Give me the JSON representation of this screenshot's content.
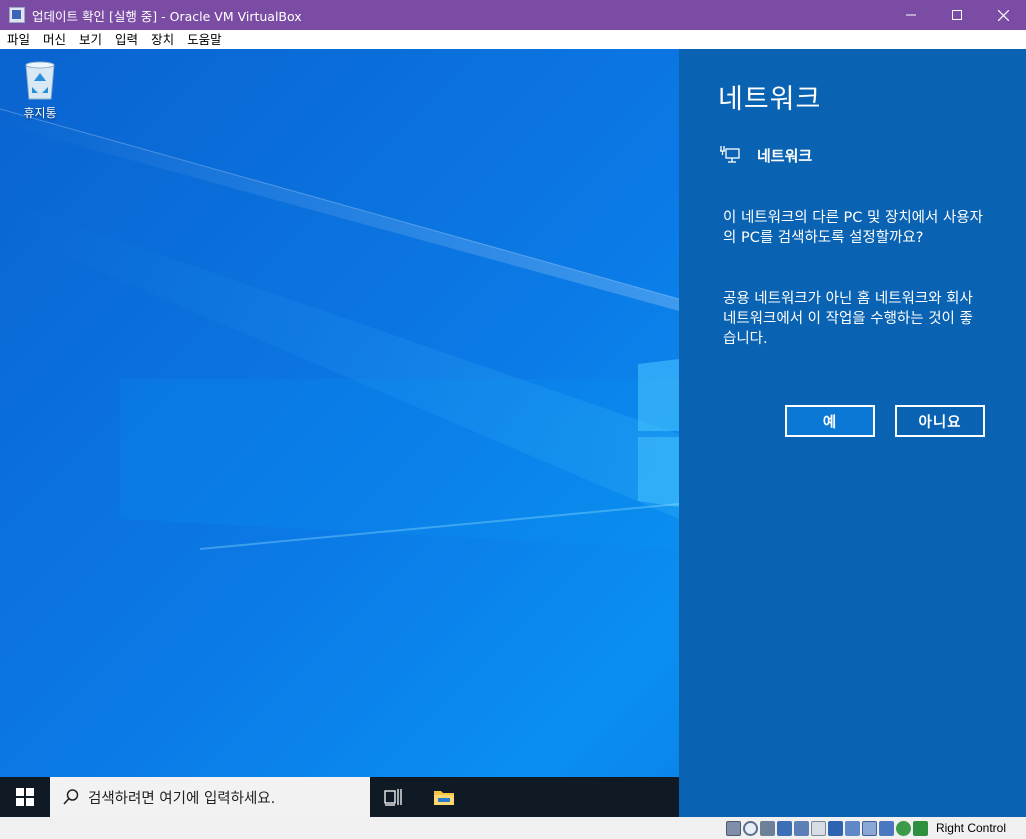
{
  "window": {
    "title": "업데이트 확인 [실행 중] - Oracle VM VirtualBox",
    "minimize": "—",
    "maximize": "☐",
    "close": "✕"
  },
  "menu": {
    "items": [
      {
        "label": "파일"
      },
      {
        "label": "머신"
      },
      {
        "label": "보기"
      },
      {
        "label": "입력"
      },
      {
        "label": "장치"
      },
      {
        "label": "도움말"
      }
    ]
  },
  "desktop": {
    "recycle_bin_label": "휴지통"
  },
  "network_flyout": {
    "title": "네트워크",
    "network_name": "네트워크",
    "question": "이 네트워크의 다른 PC 및 장치에서 사용자의 PC를 검색하도록 설정할까요?",
    "advice": "공용 네트워크가 아닌 홈 네트워크와 회사 네트워크에서 이 작업을 수행하는 것이 좋습니다.",
    "yes_label": "예",
    "no_label": "아니요",
    "colors": {
      "panel": "#0a63b2",
      "yes_button": "#0b78d6"
    }
  },
  "taskbar": {
    "search_placeholder": "검색하려면 여기에 입력하세요.",
    "colors": {
      "background": "#0f1a24",
      "search_box": "#f2f2f2"
    }
  },
  "statusbar": {
    "host_key": "Right Control",
    "icons": [
      "hard-disk-icon",
      "optical-drive-icon",
      "audio-icon",
      "network-icon",
      "usb-icon",
      "shared-folders-icon",
      "display-icon",
      "recording-icon",
      "cpu-icon",
      "vt-x-icon",
      "mouse-integration-icon",
      "keyboard-capture-icon"
    ]
  },
  "colors": {
    "titlebar": "#7b4ca4",
    "desktop": "#0b7ae6"
  }
}
